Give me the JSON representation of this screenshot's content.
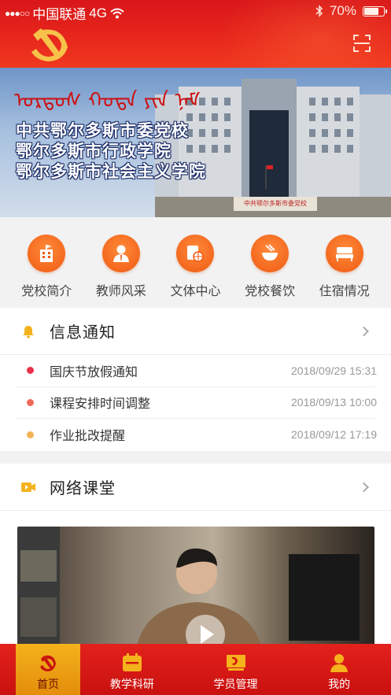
{
  "status_bar": {
    "carrier": "中国联通",
    "network": "4G",
    "battery": "70%",
    "icons": [
      "signal-dots-icon",
      "wifi-icon",
      "bluetooth-icon",
      "battery-icon"
    ]
  },
  "header": {
    "logo_icon": "hammer-sickle-icon",
    "scan_icon": "scan-icon"
  },
  "banner": {
    "mongolian_text": "ᠣᠷᠳᠣᠰ ᠬᠣᠲᠠ ᠶᠢᠨ ᠨᠠᠮ",
    "lines": [
      "中共鄂尔多斯市委党校",
      "鄂尔多斯市行政学院",
      "鄂尔多斯市社会主义学院"
    ],
    "sign_text": "中共鄂尔多斯市委党校"
  },
  "quick_menu": [
    {
      "label": "党校简介",
      "icon": "building-icon"
    },
    {
      "label": "教师风采",
      "icon": "teacher-icon"
    },
    {
      "label": "文体中心",
      "icon": "sports-icon"
    },
    {
      "label": "党校餐饮",
      "icon": "bowl-icon"
    },
    {
      "label": "住宿情况",
      "icon": "bed-icon"
    }
  ],
  "notice": {
    "title": "信息通知",
    "icon": "bell-icon",
    "items": [
      {
        "title": "国庆节放假通知",
        "date": "2018/09/29  15:31",
        "dot_color": "#e8304a"
      },
      {
        "title": "课程安排时间调整",
        "date": "2018/09/13  10:00",
        "dot_color": "#ef6a5a"
      },
      {
        "title": "作业批改提醒",
        "date": "2018/09/12  17:19",
        "dot_color": "#f2b356"
      }
    ]
  },
  "online_class": {
    "title": "网络课堂",
    "icon": "video-camera-icon",
    "play_icon": "play-icon"
  },
  "tabbar": [
    {
      "label": "首页",
      "icon": "hammer-sickle-icon",
      "active": true
    },
    {
      "label": "教学科研",
      "icon": "calendar-icon",
      "active": false
    },
    {
      "label": "学员管理",
      "icon": "party-flag-icon",
      "active": false
    },
    {
      "label": "我的",
      "icon": "person-icon",
      "active": false
    }
  ],
  "colors": {
    "header_red": "#e3211d",
    "accent_orange": "#ef5a12",
    "active_tab_gold": "#f3b21c",
    "icon_gold": "#f5b21c"
  }
}
